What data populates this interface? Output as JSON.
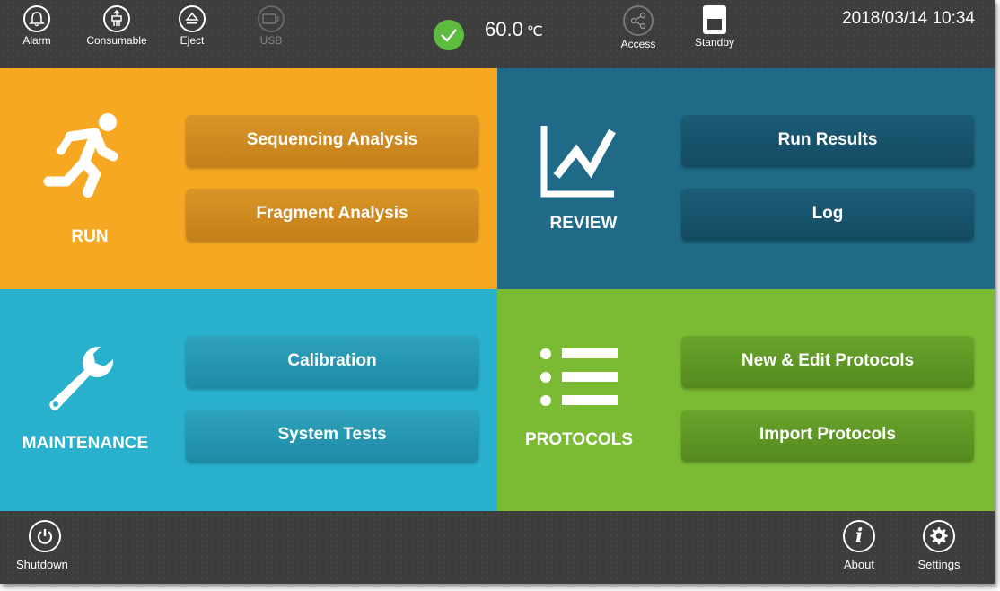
{
  "topbar": {
    "alarm_label": "Alarm",
    "consumable_label": "Consumable",
    "eject_label": "Eject",
    "usb_label": "USB",
    "temperature_value": "60.0",
    "temperature_unit": "℃",
    "access_label": "Access",
    "standby_label": "Standby",
    "datetime": "2018/03/14 10:34"
  },
  "tiles": {
    "run": {
      "label": "RUN",
      "buttons": [
        "Sequencing Analysis",
        "Fragment Analysis"
      ]
    },
    "review": {
      "label": "REVIEW",
      "buttons": [
        "Run Results",
        "Log"
      ]
    },
    "maintenance": {
      "label": "MAINTENANCE",
      "buttons": [
        "Calibration",
        "System Tests"
      ]
    },
    "protocols": {
      "label": "PROTOCOLS",
      "buttons": [
        "New & Edit Protocols",
        "Import Protocols"
      ]
    }
  },
  "bottombar": {
    "shutdown_label": "Shutdown",
    "about_label": "About",
    "settings_label": "Settings"
  },
  "colors": {
    "run": "#f6a823",
    "review": "#1f6a86",
    "maintenance": "#28b0cc",
    "protocols": "#7bbb33",
    "status_ok": "#5dbb3f"
  },
  "icons": {
    "alarm": "bell-icon",
    "consumable": "consumable-icon",
    "eject": "eject-icon",
    "usb": "usb-icon",
    "status": "checkmark-icon",
    "access": "share-icon",
    "standby": "standby-icon",
    "run": "running-person-icon",
    "review": "line-chart-icon",
    "maintenance": "wrench-icon",
    "protocols": "list-icon",
    "shutdown": "power-icon",
    "about": "info-icon",
    "settings": "gear-icon"
  }
}
